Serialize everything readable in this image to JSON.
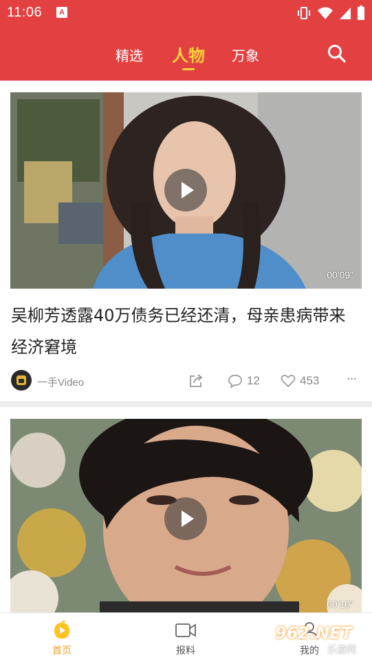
{
  "status_bar": {
    "time": "11:06",
    "notification_glyph": "A",
    "icons": [
      "vibrate-icon",
      "wifi-icon",
      "signal-icon",
      "battery-icon"
    ]
  },
  "header": {
    "tabs": [
      {
        "label": "精选",
        "active": false
      },
      {
        "label": "人物",
        "active": true
      },
      {
        "label": "万象",
        "active": false
      }
    ],
    "search_icon": "search-icon"
  },
  "feed": {
    "items": [
      {
        "duration": "00'09\"",
        "title": "吴柳芳透露40万债务已经还清，母亲患病带来经济窘境",
        "source": "一手Video",
        "comments": "12",
        "likes": "453",
        "more": "···"
      },
      {
        "duration": "00'10\""
      }
    ]
  },
  "bottom_nav": {
    "items": [
      {
        "label": "首页",
        "icon": "home-icon",
        "active": true
      },
      {
        "label": "报料",
        "icon": "video-camera-icon",
        "active": false
      },
      {
        "label": "我的",
        "icon": "profile-icon",
        "active": false
      }
    ]
  },
  "watermark": {
    "logo": "962.NET",
    "subtitle": "乐游网"
  },
  "colors": {
    "header_red": "#e34141",
    "active_tab": "#ffd23a",
    "active_nav": "#f0a020"
  }
}
